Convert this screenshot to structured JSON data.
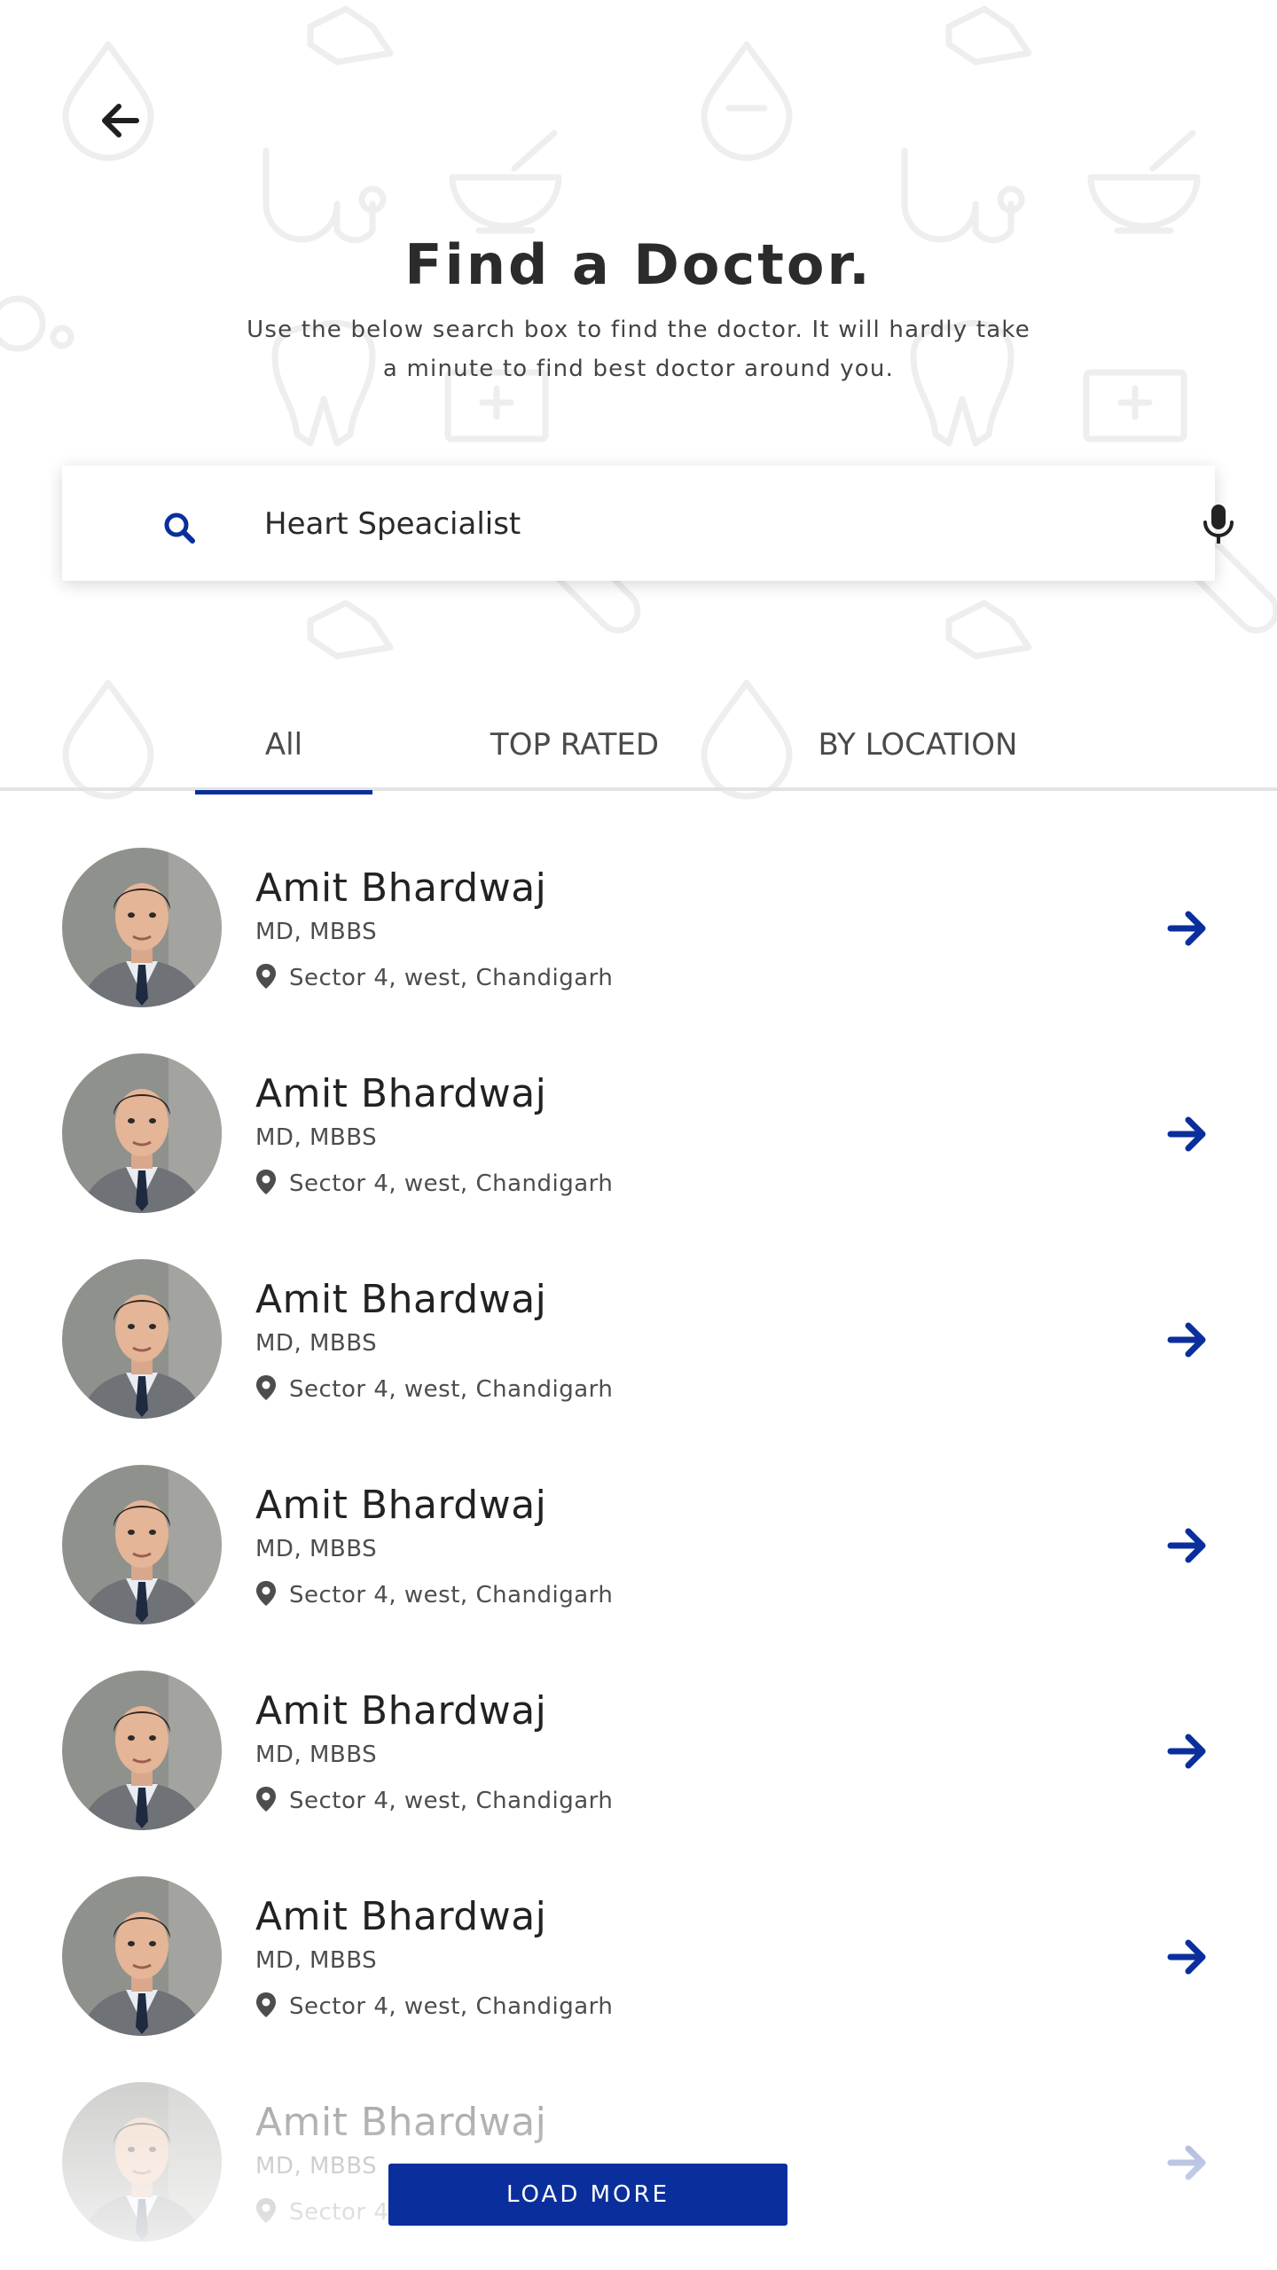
{
  "header": {
    "back_icon": "arrow-left-icon",
    "title": "Find a Doctor.",
    "subtitle": "Use the below search box to find the doctor. It will hardly take a minute to find best doctor around you."
  },
  "search": {
    "value": "Heart Speacialist",
    "search_icon": "search-icon",
    "mic_icon": "microphone-icon"
  },
  "tabs": [
    {
      "label": "All",
      "active": true
    },
    {
      "label": "TOP RATED",
      "active": false
    },
    {
      "label": "BY LOCATION",
      "active": false
    }
  ],
  "doctors": [
    {
      "name": "Amit Bhardwaj",
      "degree": "MD, MBBS",
      "location": "Sector 4, west, Chandigarh"
    },
    {
      "name": "Amit Bhardwaj",
      "degree": "MD, MBBS",
      "location": "Sector 4, west, Chandigarh"
    },
    {
      "name": "Amit Bhardwaj",
      "degree": "MD, MBBS",
      "location": "Sector 4, west, Chandigarh"
    },
    {
      "name": "Amit Bhardwaj",
      "degree": "MD, MBBS",
      "location": "Sector 4, west, Chandigarh"
    },
    {
      "name": "Amit Bhardwaj",
      "degree": "MD, MBBS",
      "location": "Sector 4, west, Chandigarh"
    },
    {
      "name": "Amit Bhardwaj",
      "degree": "MD, MBBS",
      "location": "Sector 4, west, Chandigarh"
    },
    {
      "name": "Amit Bhardwaj",
      "degree": "MD, MBBS",
      "location": "Sector 4, west, Chandigarh"
    }
  ],
  "load_more": {
    "label": "LOAD MORE"
  },
  "colors": {
    "accent": "#0a2f9c",
    "text": "#2a2a2a",
    "pattern": "#eeeeee"
  }
}
